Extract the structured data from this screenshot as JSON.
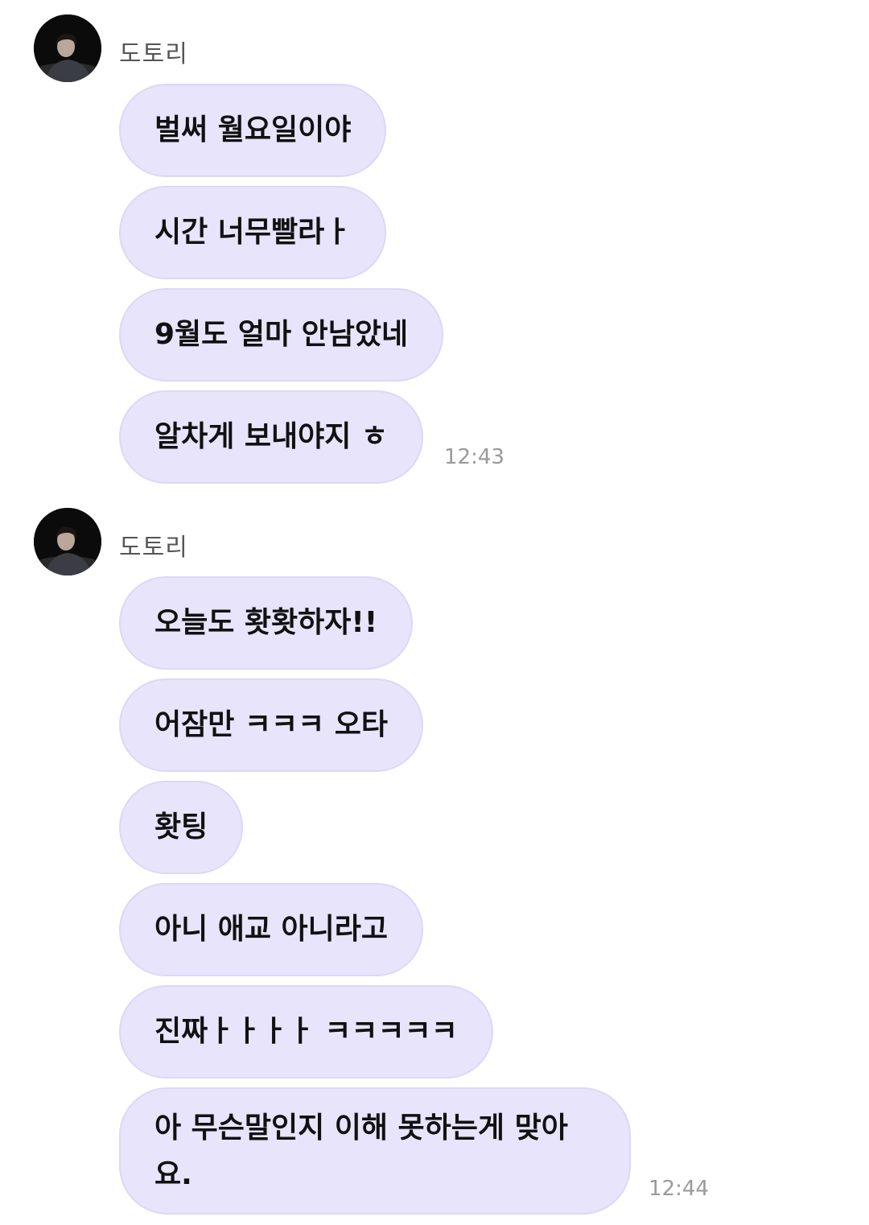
{
  "groups": [
    {
      "sender": "도토리",
      "messages": [
        "벌써 월요일이야",
        "시간 너무빨라ㅏ",
        "9월도 얼마 안남았네",
        "알차게 보내야지 ㅎ"
      ],
      "time": "12:43"
    },
    {
      "sender": "도토리",
      "messages": [
        "오늘도 홧홧하자!!",
        "어잠만 ㅋㅋㅋ 오타",
        "홧팅",
        "아니 애교 아니라고",
        "진짜ㅏㅏㅏㅏ ㅋㅋㅋㅋㅋ",
        "아 무슨말인지 이해 못하는게 맞아요."
      ],
      "time": "12:44"
    }
  ],
  "colors": {
    "bubble_background": "#e7e4fb",
    "bubble_border": "#dcd8f5",
    "timestamp": "#9a9a9a",
    "sender_name": "#555555"
  },
  "icons": {
    "avatar": "profile-photo-avatar"
  }
}
